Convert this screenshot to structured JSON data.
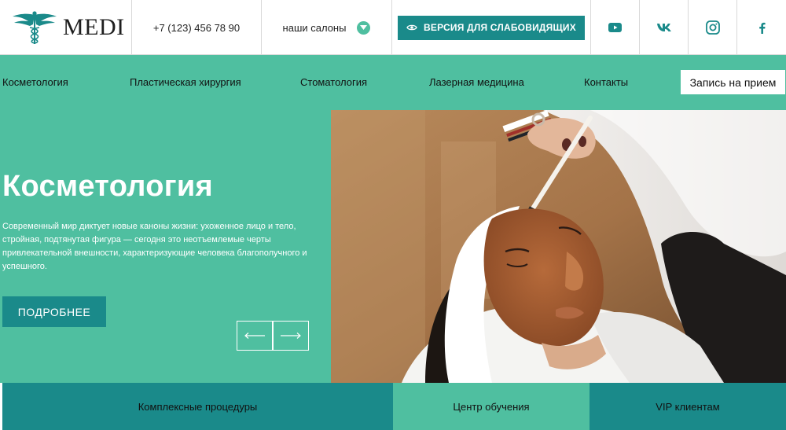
{
  "brand": {
    "name": "MEDI",
    "logo_icon": "caduceus-icon"
  },
  "colors": {
    "teal_light": "#4fbfa0",
    "teal_dark": "#1a8a8a",
    "white": "#ffffff"
  },
  "header": {
    "phone": "+7 (123) 456 78 90",
    "salons_label": "наши салоны",
    "vision_button": "ВЕРСИЯ ДЛЯ СЛАБОВИДЯЩИХ",
    "social": [
      "youtube-icon",
      "vk-icon",
      "instagram-icon",
      "facebook-icon"
    ]
  },
  "nav": {
    "items": [
      "Косметология",
      "Пластическая хирургия",
      "Стоматология",
      "Лазерная медицина",
      "Контакты"
    ],
    "cta": "Запись на прием"
  },
  "hero": {
    "title": "Косметология",
    "text": "Современный мир диктует новые каноны жизни: ухоженное лицо и тело, стройная, подтянутая фигура — сегодня это неотъемлемые черты привлекательной внешности, характеризующие человека благополучного и успешного.",
    "button": "ПОДРОБНЕЕ",
    "prev_icon": "arrow-left-icon",
    "next_icon": "arrow-right-icon"
  },
  "tiles": [
    "Комплексные процедуры",
    "Центр обучения",
    "VIP клиентам"
  ]
}
